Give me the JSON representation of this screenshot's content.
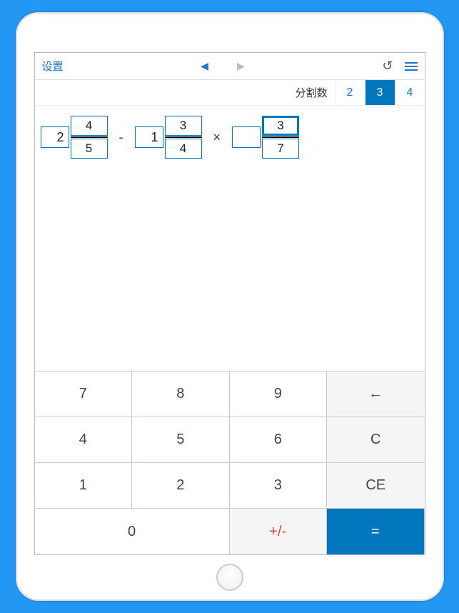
{
  "topbar": {
    "settings_label": "设置",
    "prev_arrow": "◀",
    "next_arrow": "▶",
    "undo_glyph": "↺"
  },
  "segment": {
    "label": "分割数",
    "options": [
      "2",
      "3",
      "4"
    ],
    "active_index": 1
  },
  "expression": {
    "terms": [
      {
        "whole": "2",
        "num": "4",
        "den": "5",
        "focused": false
      },
      {
        "whole": "1",
        "num": "3",
        "den": "4",
        "focused": false
      },
      {
        "whole": "",
        "num": "3",
        "den": "7",
        "focused": true
      }
    ],
    "operators": [
      "-",
      "×"
    ]
  },
  "keypad": {
    "rows": [
      [
        "7",
        "8",
        "9",
        "←"
      ],
      [
        "4",
        "5",
        "6",
        "C"
      ],
      [
        "1",
        "2",
        "3",
        "CE"
      ]
    ],
    "zero": "0",
    "plusminus": "+/-",
    "equals": "="
  }
}
